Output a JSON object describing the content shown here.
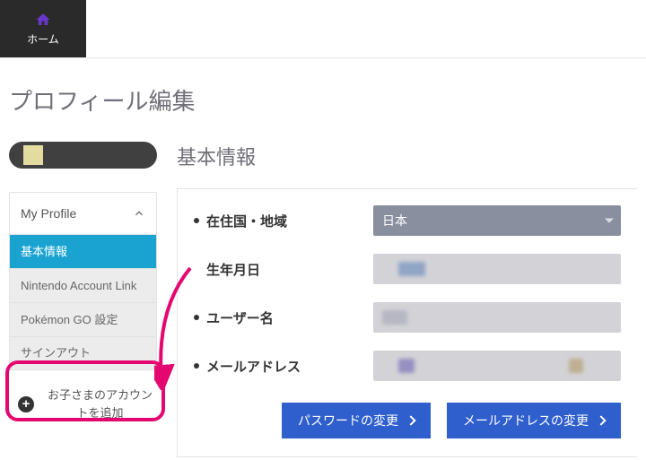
{
  "topbar": {
    "home_label": "ホーム"
  },
  "page_title": "プロフィール編集",
  "sidebar": {
    "head": "My Profile",
    "items": [
      {
        "label": "基本情報",
        "active": true
      },
      {
        "label": "Nintendo Account Link",
        "active": false
      },
      {
        "label": "Pokémon GO 設定",
        "active": false
      },
      {
        "label": "サインアウト",
        "active": false
      }
    ],
    "add_child_label": "お子さまのアカウントを追加"
  },
  "section_title": "基本情報",
  "form": {
    "country_label": "在住国・地域",
    "country_value": "日本",
    "birthdate_label": "生年月日",
    "username_label": "ユーザー名",
    "email_label": "メールアドレス"
  },
  "buttons": {
    "change_password": "パスワードの変更",
    "change_email": "メールアドレスの変更"
  }
}
